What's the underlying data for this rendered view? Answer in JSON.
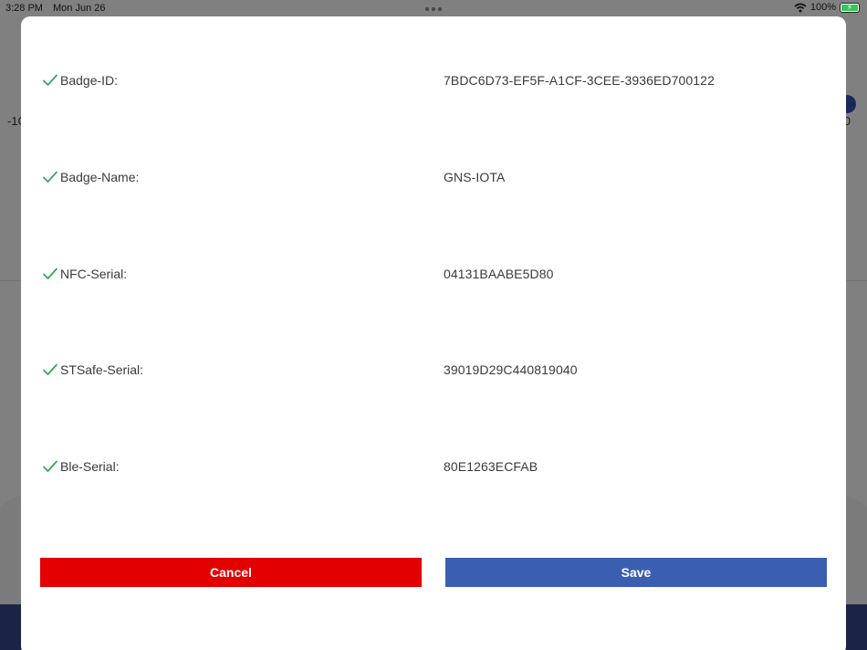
{
  "status_bar": {
    "time": "3:28 PM",
    "date": "Mon Jun 26",
    "battery": "100%"
  },
  "background": {
    "left_edge_text": "-1C",
    "right_edge_text": "0"
  },
  "modal": {
    "rows": [
      {
        "label": "Badge-ID:",
        "value": "7BDC6D73-EF5F-A1CF-3CEE-3936ED700122",
        "status": "check-icon"
      },
      {
        "label": "Badge-Name:",
        "value": "GNS-IOTA",
        "status": "check-icon"
      },
      {
        "label": "NFC-Serial:",
        "value": "04131BAABE5D80",
        "status": "check-icon"
      },
      {
        "label": "STSafe-Serial:",
        "value": "39019D29C440819040",
        "status": "check-icon"
      },
      {
        "label": "Ble-Serial:",
        "value": "80E1263ECFAB",
        "status": "check-icon"
      }
    ],
    "cancel_label": "Cancel",
    "save_label": "Save"
  },
  "colors": {
    "check": "#34a853",
    "cancel": "#e20000",
    "save": "#3a5fb1"
  }
}
